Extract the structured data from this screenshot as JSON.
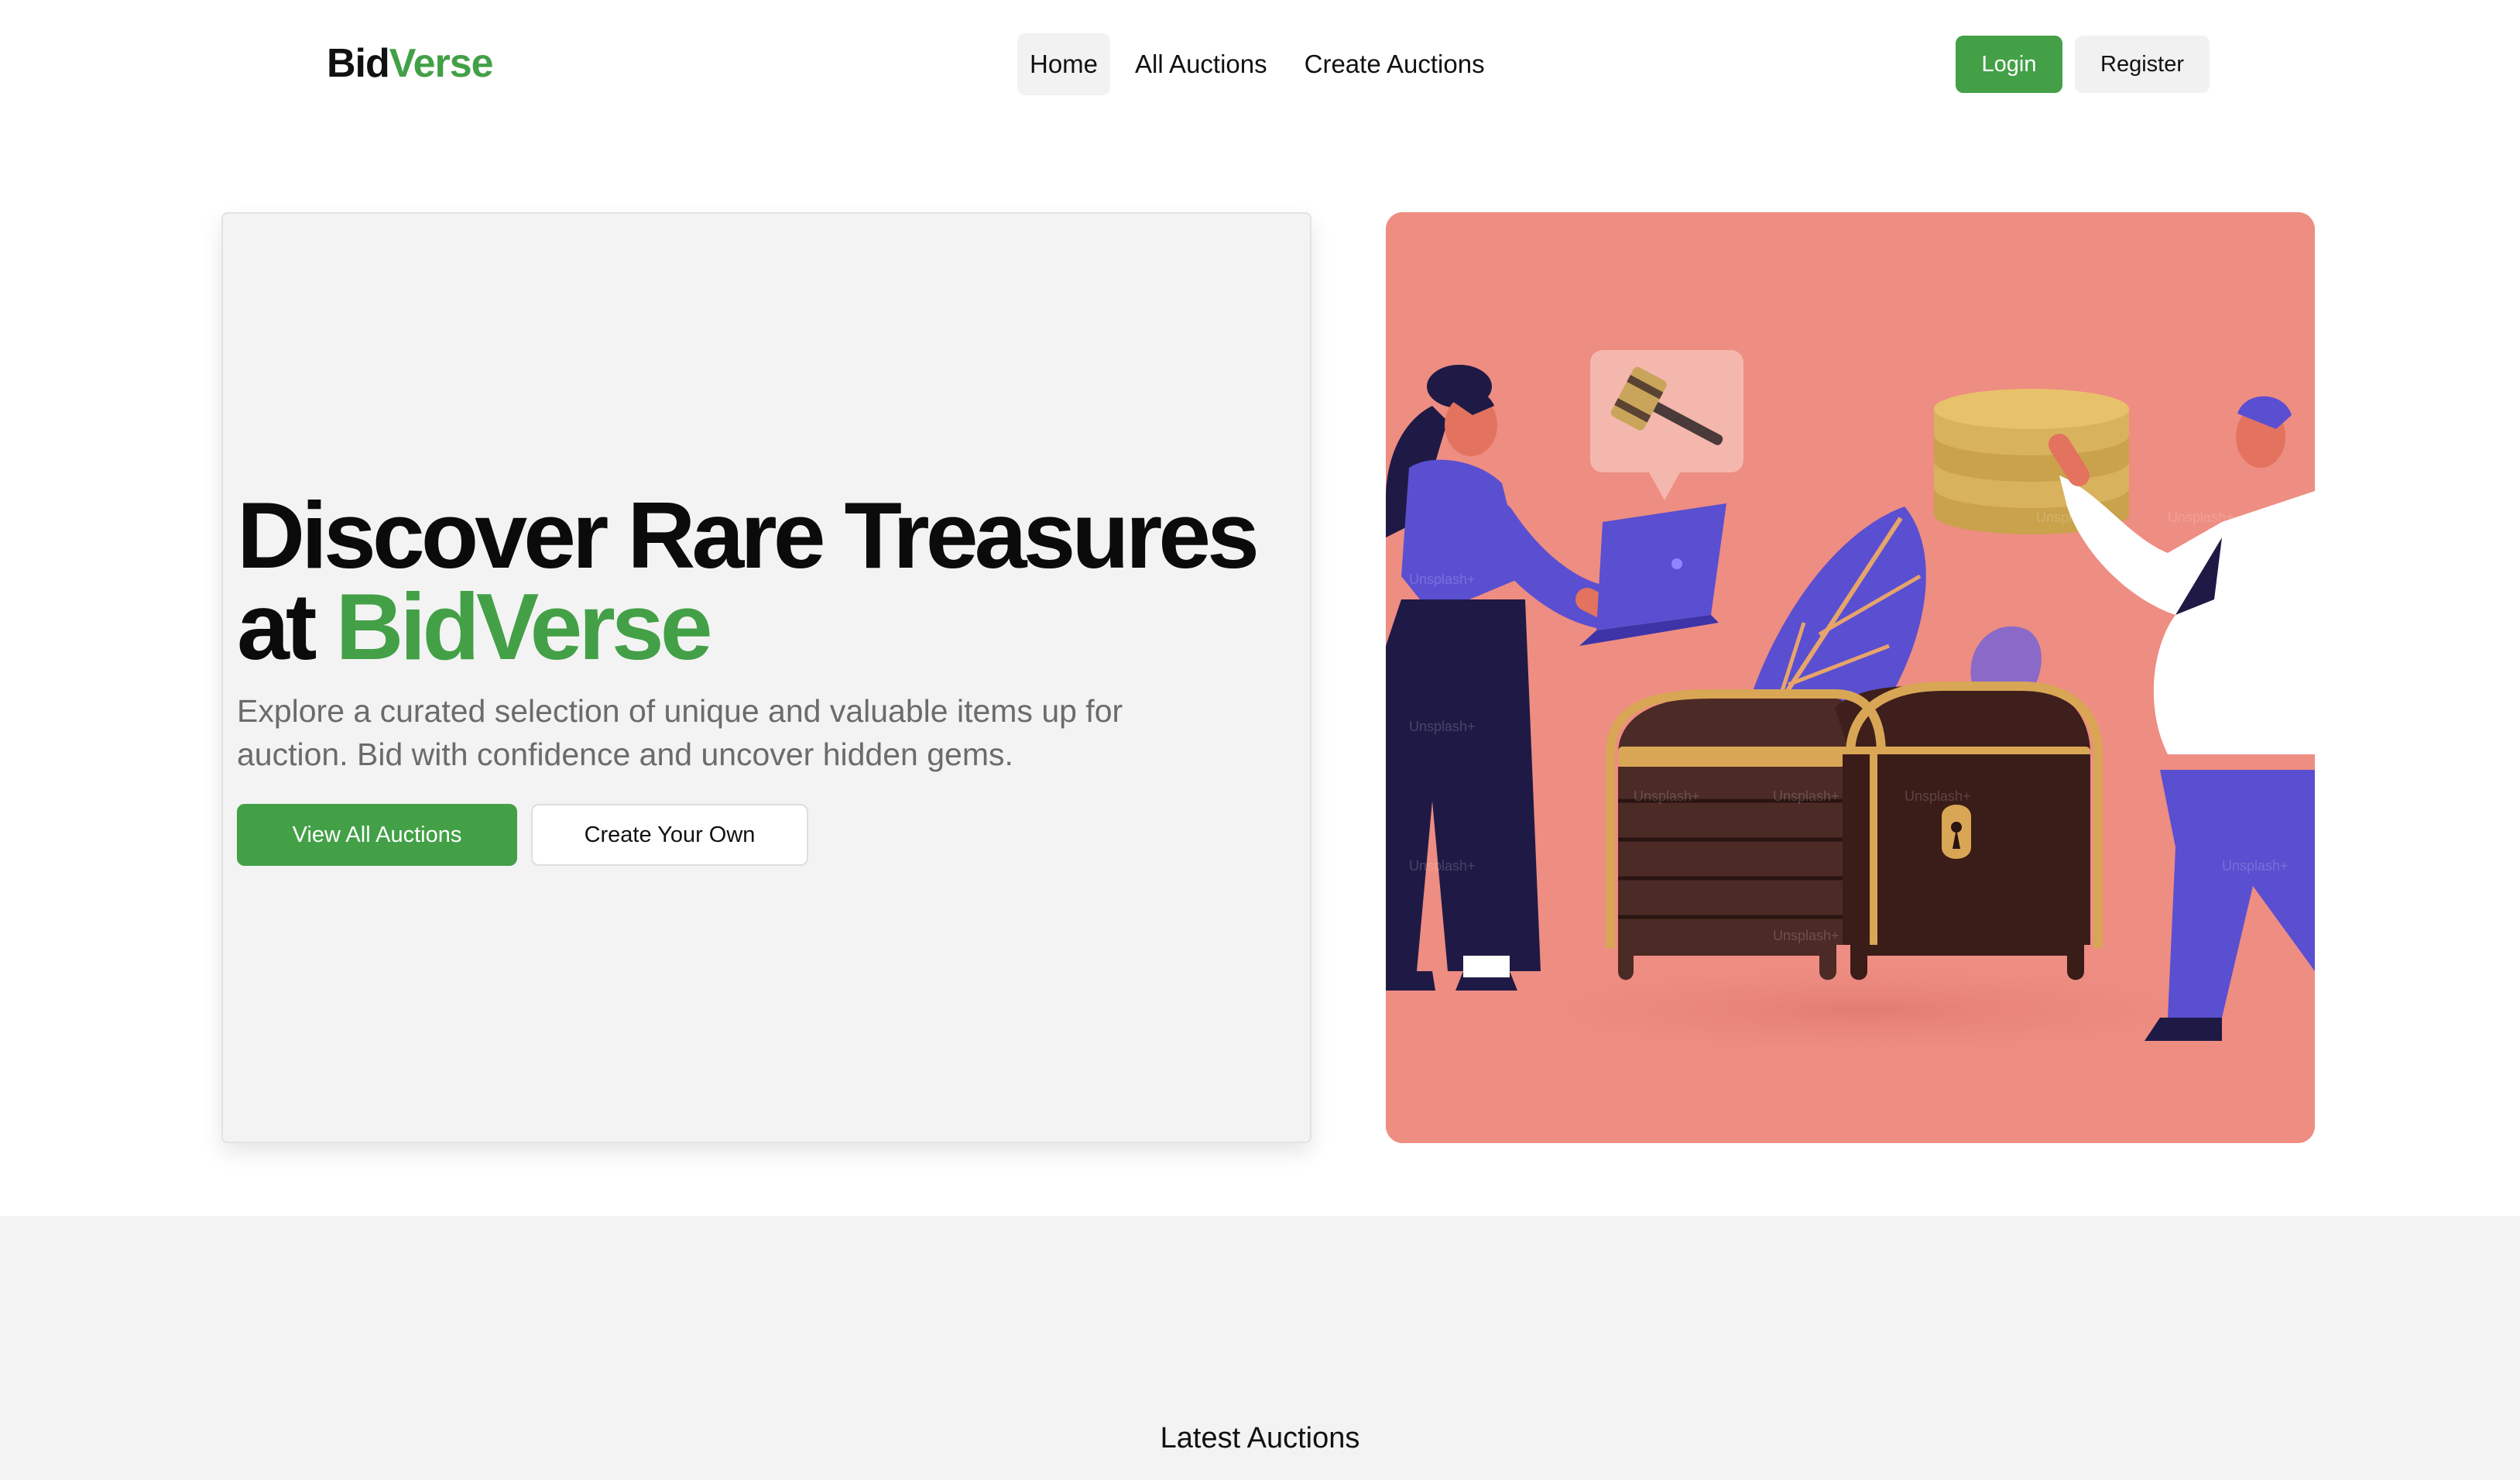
{
  "brand": {
    "part1": "Bid",
    "part2": "Verse"
  },
  "nav": {
    "items": [
      {
        "label": "Home",
        "active": true
      },
      {
        "label": "All Auctions",
        "active": false
      },
      {
        "label": "Create Auctions",
        "active": false
      }
    ]
  },
  "auth": {
    "login_label": "Login",
    "register_label": "Register"
  },
  "hero": {
    "title_line1": "Discover Rare Treasures",
    "title_line2_prefix": "at ",
    "title_line2_brand": "BidVerse",
    "subtitle": "Explore a curated selection of unique and valuable items up for auction. Bid with confidence and uncover hidden gems.",
    "primary_cta": "View All Auctions",
    "secondary_cta": "Create Your Own"
  },
  "illustration": {
    "watermark": "Unsplash+"
  },
  "latest": {
    "title": "Latest Auctions"
  },
  "colors": {
    "accent": "#43a047",
    "hero_card_bg": "#f3f3f3",
    "illustration_bg": "#ee8d82",
    "section_bg": "#f3f3f3"
  }
}
